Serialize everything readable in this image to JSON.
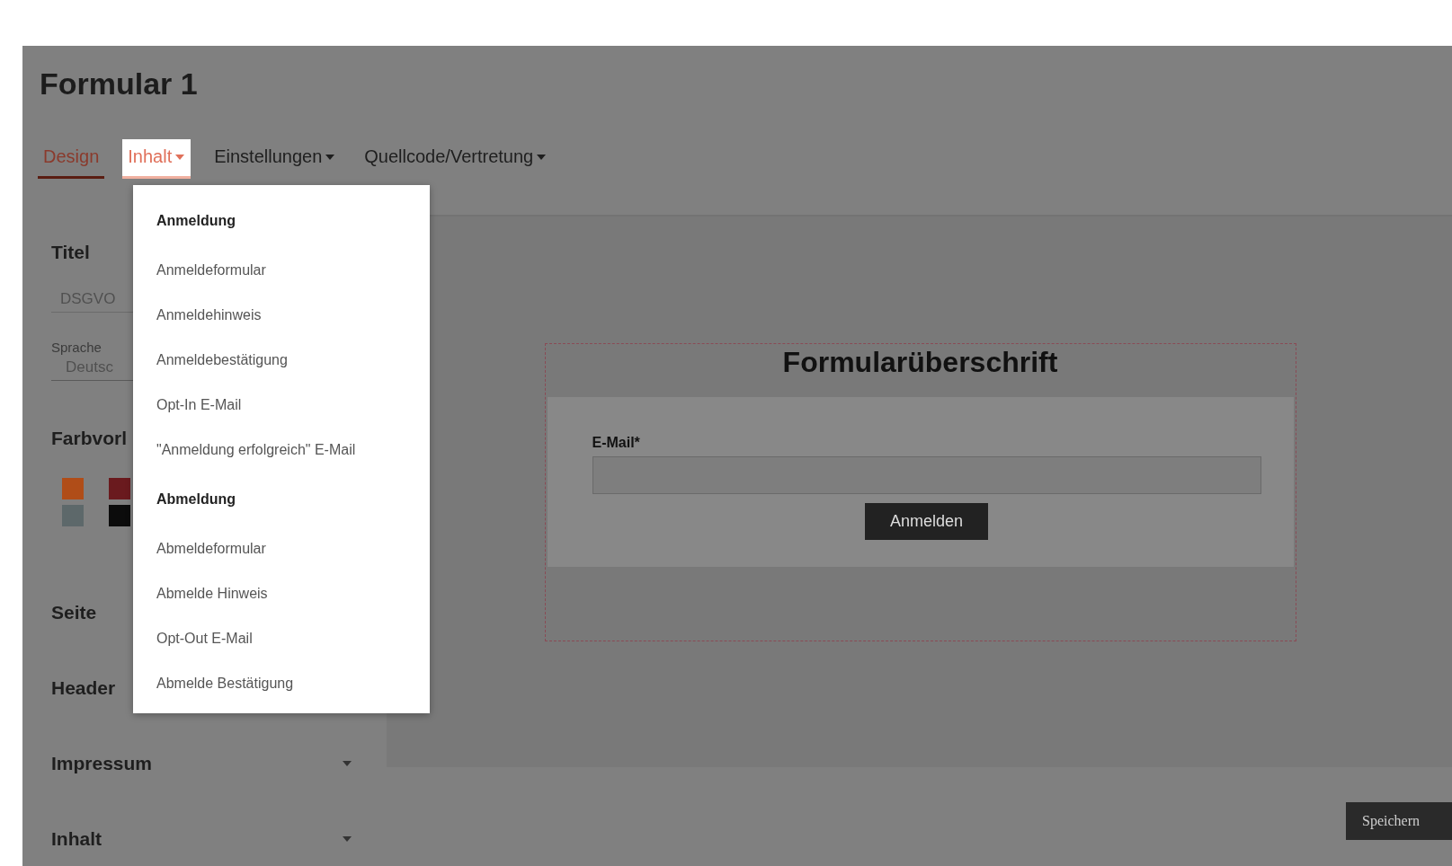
{
  "page_title": "Formular 1",
  "tabs": [
    {
      "label": "Design",
      "selected": true,
      "open": false,
      "menu": false
    },
    {
      "label": "Inhalt",
      "selected": false,
      "open": true,
      "menu": true
    },
    {
      "label": "Einstellungen",
      "selected": false,
      "open": false,
      "menu": true
    },
    {
      "label": "Quellcode/Vertretung",
      "selected": false,
      "open": false,
      "menu": true
    }
  ],
  "dropdown": [
    {
      "kind": "heading",
      "label": "Anmeldung"
    },
    {
      "kind": "item",
      "label": "Anmeldeformular"
    },
    {
      "kind": "item",
      "label": "Anmeldehinweis"
    },
    {
      "kind": "item",
      "label": "Anmeldebestätigung"
    },
    {
      "kind": "item",
      "label": "Opt-In E-Mail"
    },
    {
      "kind": "item",
      "label": "\"Anmeldung erfolgreich\" E-Mail"
    },
    {
      "kind": "heading",
      "label": "Abmeldung"
    },
    {
      "kind": "item",
      "label": "Abmeldeformular"
    },
    {
      "kind": "item",
      "label": "Abmelde Hinweis"
    },
    {
      "kind": "item",
      "label": "Opt-Out E-Mail"
    },
    {
      "kind": "item",
      "label": "Abmelde Bestätigung"
    }
  ],
  "sidebar": {
    "title_heading": "Titel",
    "title_value": "DSGVO",
    "language_label": "Sprache",
    "language_value": "Deutsc",
    "colors_heading": "Farbvorl",
    "swatches": [
      {
        "color": "#b04d18"
      },
      {
        "color": "#6a1a1e"
      },
      {
        "color": "#5d686a"
      },
      {
        "color": "#0c0c0c"
      }
    ],
    "sections": [
      {
        "label": "Seite",
        "caret": false
      },
      {
        "label": "Header",
        "caret": false
      },
      {
        "label": "Impressum",
        "caret": true
      },
      {
        "label": "Inhalt",
        "caret": true
      }
    ]
  },
  "preview": {
    "heading": "Formularüberschrift",
    "field_label": "E-Mail*",
    "submit": "Anmelden"
  },
  "save_button": "Speichern"
}
